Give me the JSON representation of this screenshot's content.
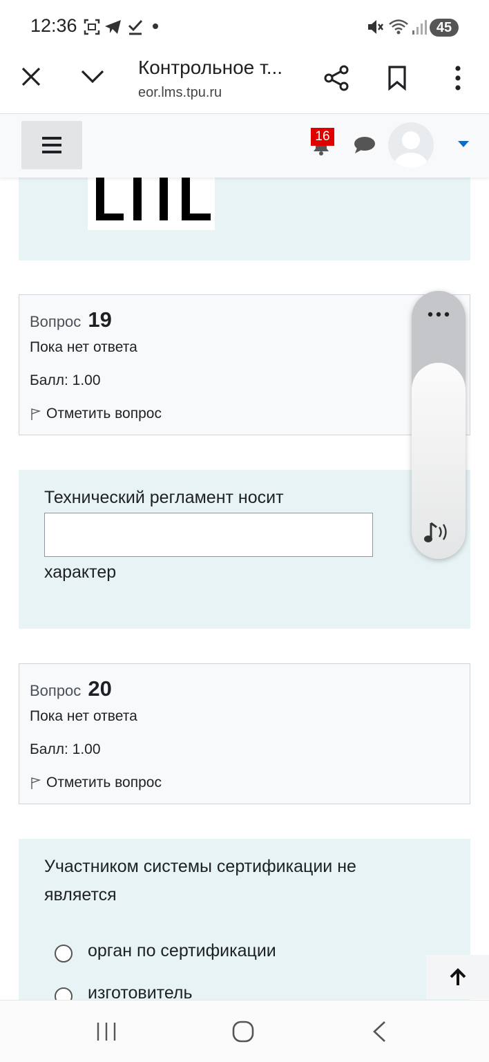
{
  "status_bar": {
    "time": "12:36",
    "battery": "45",
    "icons": [
      "screenshot-icon",
      "telegram-icon",
      "download-done-icon",
      "dot-icon",
      "mute-icon",
      "wifi-icon",
      "signal-icon"
    ]
  },
  "browser": {
    "tab_title": "Контрольное т...",
    "url": "eor.lms.tpu.ru",
    "icons": [
      "close-icon",
      "chevron-down-icon",
      "share-icon",
      "bookmark-icon",
      "more-vert-icon"
    ]
  },
  "navbar": {
    "notifications_count": "16",
    "icons": [
      "hamburger-icon",
      "bell-icon",
      "chat-icon",
      "avatar",
      "caret-down-icon"
    ]
  },
  "question19": {
    "label": "Вопрос",
    "number": "19",
    "state": "Пока нет ответа",
    "grade": "Балл: 1.00",
    "flag": "Отметить вопрос",
    "text_before": "Технический регламент носит",
    "text_after": "характер",
    "answer_value": ""
  },
  "question20": {
    "label": "Вопрос",
    "number": "20",
    "state": "Пока нет ответа",
    "grade": "Балл: 1.00",
    "flag": "Отметить вопрос",
    "text": "Участником системы сертификации не является",
    "options": [
      "орган по сертификации",
      "изготовитель"
    ]
  },
  "colors": {
    "answer_bg": "#e7f3f5",
    "info_bg": "#f8f9fa",
    "badge": "#e00000",
    "caret": "#0f6cbf"
  }
}
